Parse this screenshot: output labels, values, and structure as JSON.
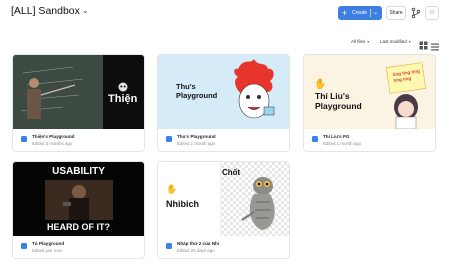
{
  "header": {
    "title": "[ALL] Sandbox",
    "create_label": "Create",
    "share_label": "Share"
  },
  "filters": {
    "type_label": "All files",
    "sort_label": "Last modified"
  },
  "cards": [
    {
      "title": "Thiện's Playground",
      "meta": "Edited 3 months ago",
      "thumb_text": "Thiện"
    },
    {
      "title": "Thu's Playground",
      "meta": "Edited 1 month ago",
      "thumb_text": "Thu's Playground"
    },
    {
      "title": "Thí Liu's PG",
      "meta": "Edited 1 month ago",
      "thumb_text": "Thí Liu's Playground",
      "sign_text": "ting ting ting ting ting"
    },
    {
      "title": "Tú Playground",
      "meta": "Edited just now",
      "thumb_text_top": "USABILITY",
      "thumb_text_bottom": "HEARD OF IT?"
    },
    {
      "title": "Nháp thứ 2 của Nhi",
      "meta": "Edited 25 days ago",
      "thumb_text": "Nhibich",
      "thumb_text_2": "Chốt"
    }
  ],
  "colors": {
    "accent": "#3d7fe0",
    "file_icon": "#3a82e8"
  }
}
